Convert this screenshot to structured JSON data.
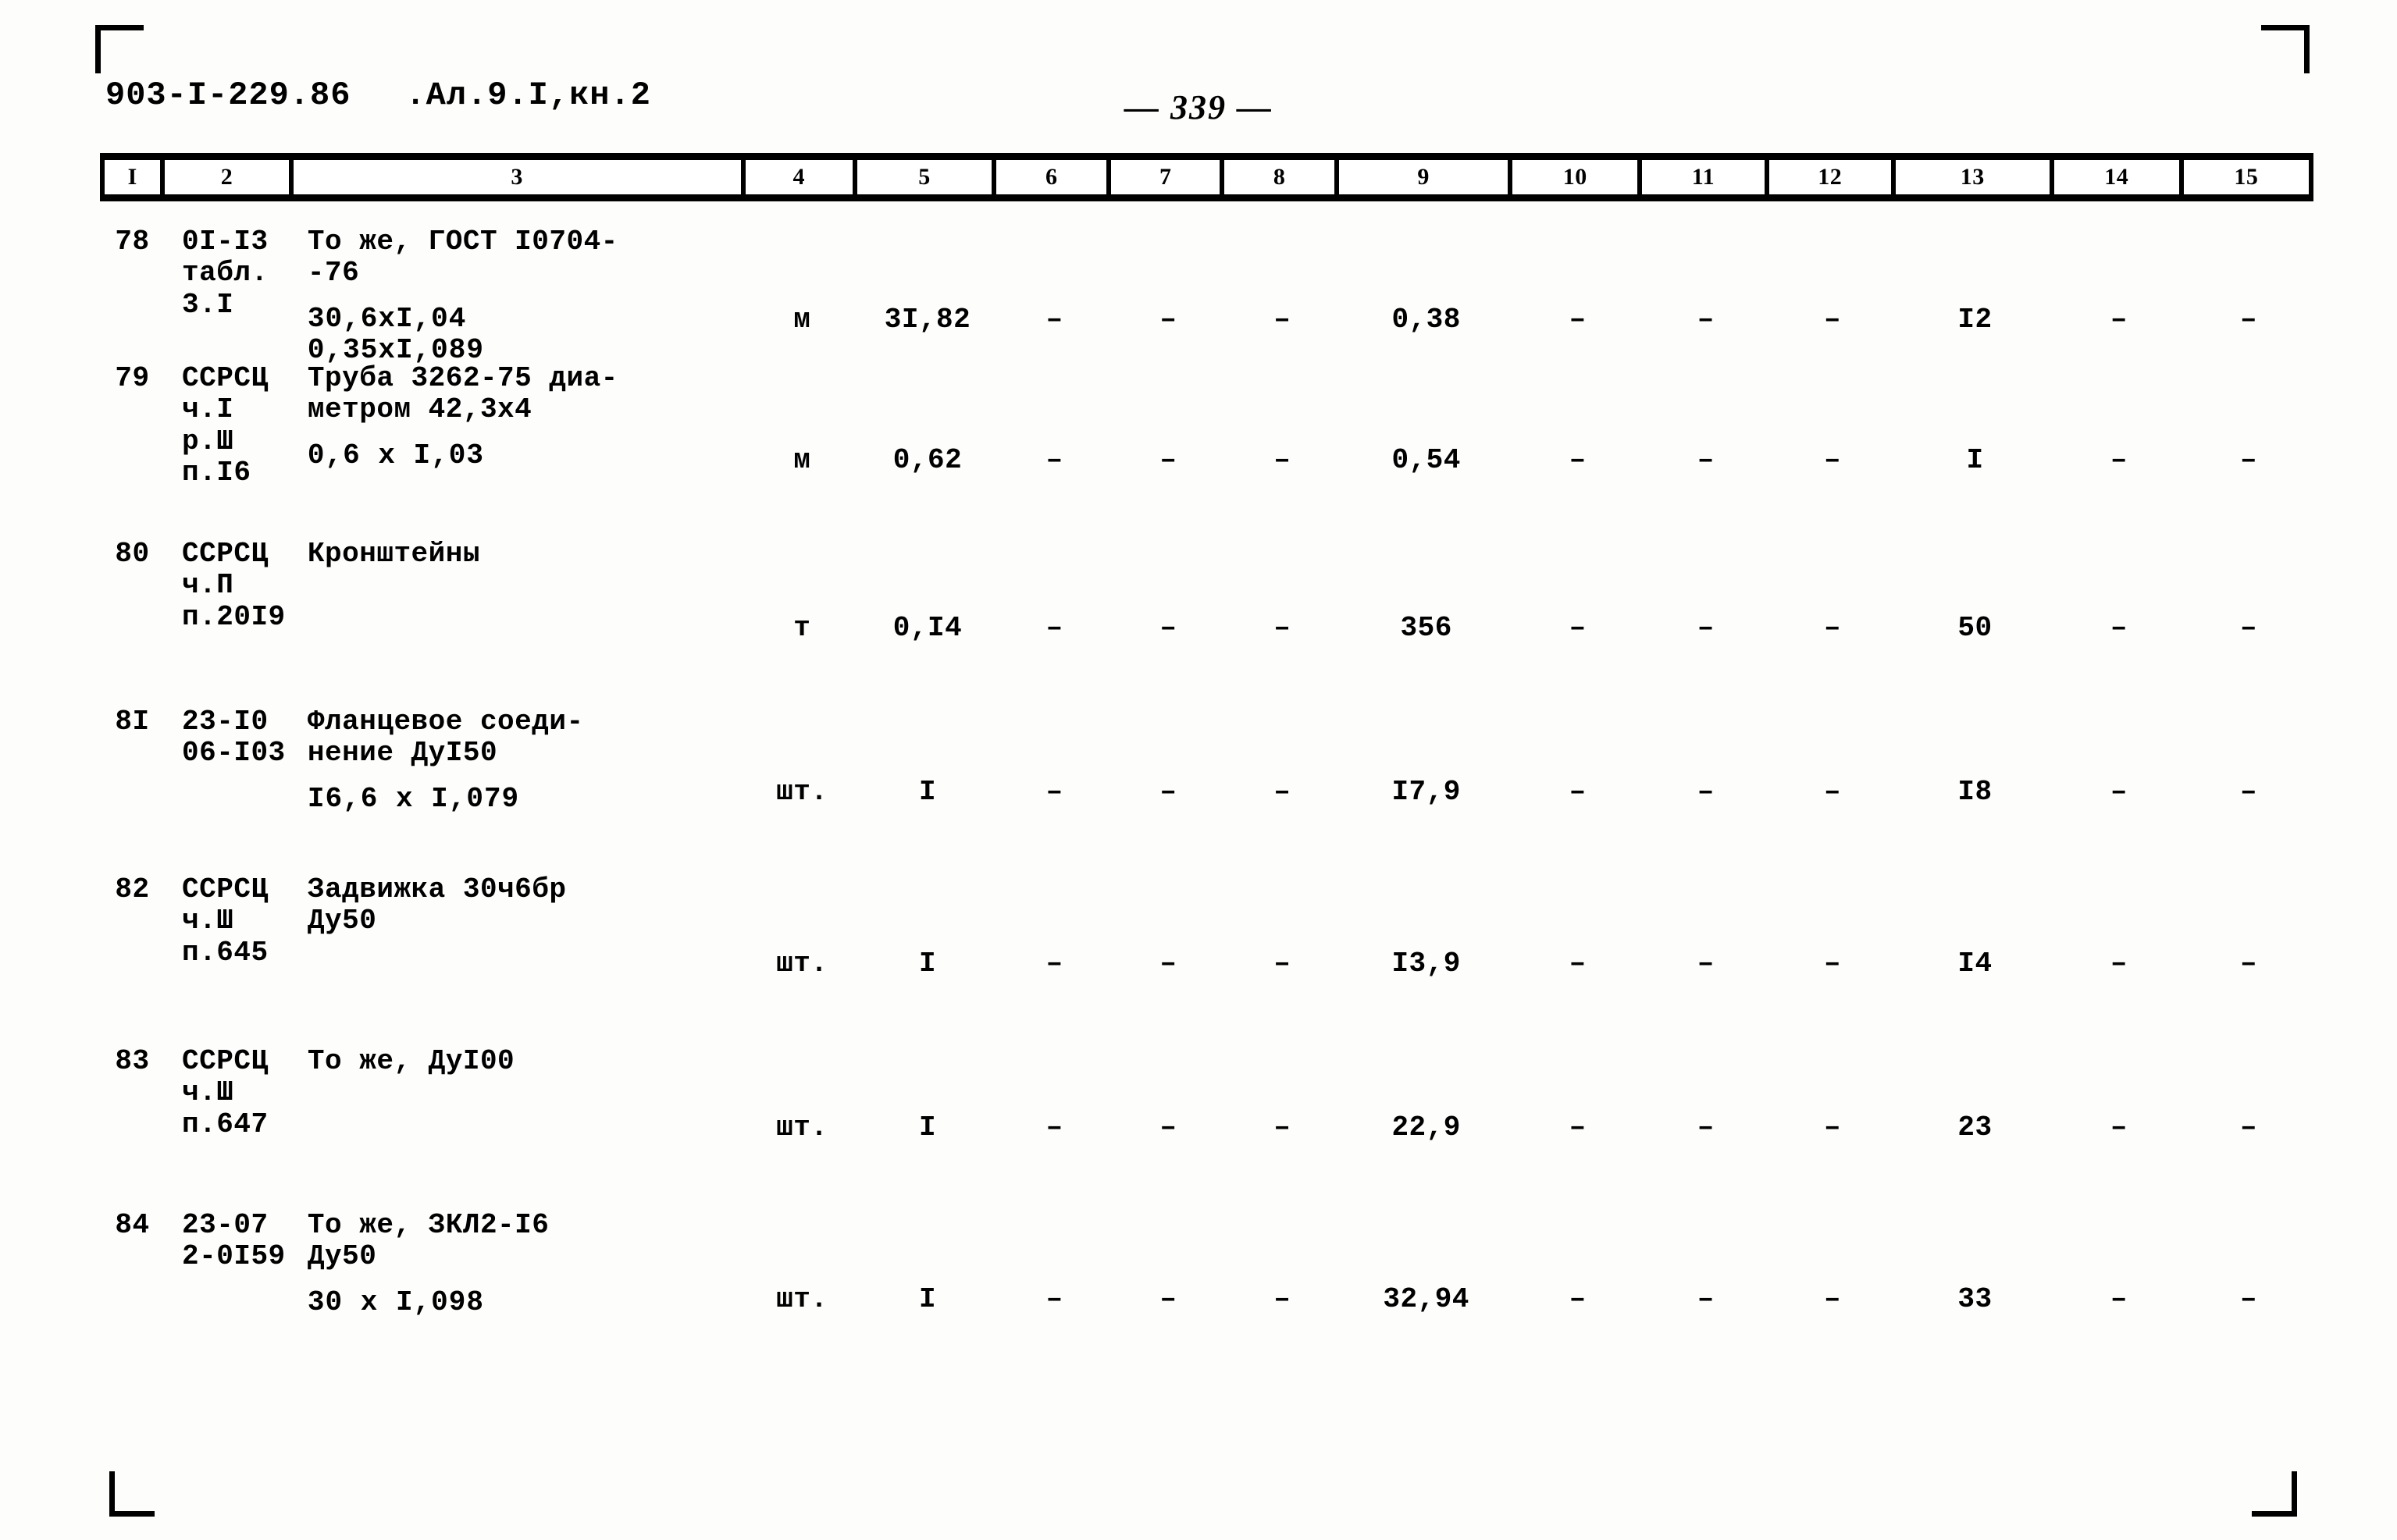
{
  "document": {
    "code": "903-I-229.86",
    "album": ".Ал.9.I,кн.2",
    "page_number": "— 339 —"
  },
  "table": {
    "column_headers": [
      "I",
      "2",
      "3",
      "4",
      "5",
      "6",
      "7",
      "8",
      "9",
      "10",
      "11",
      "12",
      "13",
      "14",
      "15"
    ],
    "rows": [
      {
        "num": "78",
        "code": "0I-I3\nтабл.\n3.I",
        "desc": "То же, ГОСТ I0704-\n-76",
        "desc_extra": "30,6xI,04\n0,35xI,089",
        "unit": "м",
        "c5": "3I,82",
        "c6": "–",
        "c7": "–",
        "c8": "–",
        "c9": "0,38",
        "c10": "–",
        "c11": "–",
        "c12": "–",
        "c13": "I2",
        "c14": "–",
        "c15": "–"
      },
      {
        "num": "79",
        "code": "ССРСЦ\nч.I\nр.Ш\nп.I6",
        "desc": "Труба 3262-75 диа-\nметром 42,3x4",
        "desc_extra": "0,6 x I,03",
        "unit": "м",
        "c5": "0,62",
        "c6": "–",
        "c7": "–",
        "c8": "–",
        "c9": "0,54",
        "c10": "–",
        "c11": "–",
        "c12": "–",
        "c13": "I",
        "c14": "–",
        "c15": "–"
      },
      {
        "num": "80",
        "code": "ССРСЦ\nч.П\nп.20I9",
        "desc": "Кронштейны",
        "desc_extra": "",
        "unit": "т",
        "c5": "0,I4",
        "c6": "–",
        "c7": "–",
        "c8": "–",
        "c9": "356",
        "c10": "–",
        "c11": "–",
        "c12": "–",
        "c13": "50",
        "c14": "–",
        "c15": "–"
      },
      {
        "num": "8I",
        "code": "23-I0\n06-I03",
        "desc": "Фланцевое соеди-\nнение ДуI50",
        "desc_extra": "I6,6 x I,079",
        "unit": "шт.",
        "c5": "I",
        "c6": "–",
        "c7": "–",
        "c8": "–",
        "c9": "I7,9",
        "c10": "–",
        "c11": "–",
        "c12": "–",
        "c13": "I8",
        "c14": "–",
        "c15": "–"
      },
      {
        "num": "82",
        "code": "ССРСЦ\nч.Ш\nп.645",
        "desc": "Задвижка 30ч6бр\nДу50",
        "desc_extra": "",
        "unit": "шт.",
        "c5": "I",
        "c6": "–",
        "c7": "–",
        "c8": "–",
        "c9": "I3,9",
        "c10": "–",
        "c11": "–",
        "c12": "–",
        "c13": "I4",
        "c14": "–",
        "c15": "–"
      },
      {
        "num": "83",
        "code": "ССРСЦ\nч.Ш\nп.647",
        "desc": "То же, ДуI00",
        "desc_extra": "",
        "unit": "шт.",
        "c5": "I",
        "c6": "–",
        "c7": "–",
        "c8": "–",
        "c9": "22,9",
        "c10": "–",
        "c11": "–",
        "c12": "–",
        "c13": "23",
        "c14": "–",
        "c15": "–"
      },
      {
        "num": "84",
        "code": "23-07\n2-0I59",
        "desc": "То же, ЗКЛ2-I6\nДу50",
        "desc_extra": "30 x I,098",
        "unit": "шт.",
        "c5": "I",
        "c6": "–",
        "c7": "–",
        "c8": "–",
        "c9": "32,94",
        "c10": "–",
        "c11": "–",
        "c12": "–",
        "c13": "33",
        "c14": "–",
        "c15": "–"
      }
    ]
  }
}
